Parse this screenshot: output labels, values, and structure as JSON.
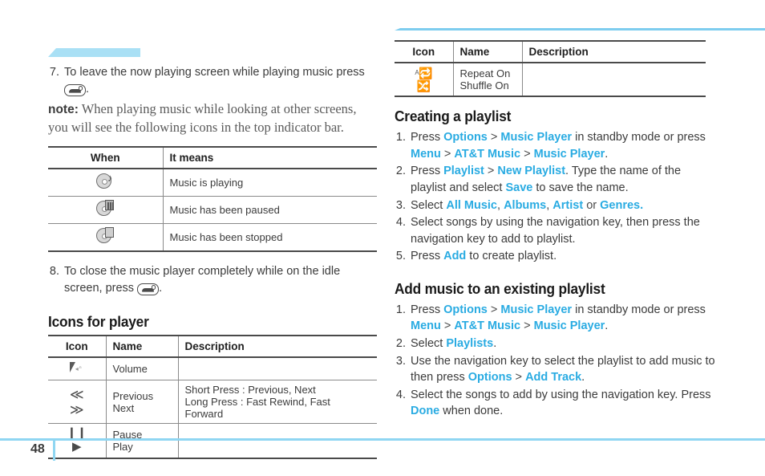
{
  "page": {
    "number": "48"
  },
  "left": {
    "step7": {
      "num": "7.",
      "text_before": "To leave the now playing screen while playing music press",
      "key_icon": "end-call-key-icon",
      "text_after": "."
    },
    "note": {
      "label": "note:",
      "text": "When playing music while looking at other screens, you will see the following icons in the top indicator bar."
    },
    "indicator_table": {
      "headers": [
        "When",
        "It means"
      ],
      "rows": [
        {
          "icon": "music-playing-icon",
          "meaning": "Music is playing"
        },
        {
          "icon": "music-paused-icon",
          "meaning": "Music has been paused"
        },
        {
          "icon": "music-stopped-icon",
          "meaning": "Music has been stopped"
        }
      ]
    },
    "step8": {
      "num": "8.",
      "line1": "To close the music player completely while on the idle",
      "line2_before": "screen, press",
      "key_icon": "end-call-key-icon",
      "line2_after": "."
    },
    "heading_icons_for_player": "Icons for player",
    "player_table": {
      "headers": [
        "Icon",
        "Name",
        "Description"
      ],
      "rows": [
        {
          "icon": "volume-icon",
          "names": [
            "Volume"
          ],
          "description": []
        },
        {
          "icon": "previous-next-icon",
          "names": [
            "Previous",
            "Next"
          ],
          "description": [
            "Short Press : Previous, Next",
            "Long Press : Fast Rewind, Fast Forward"
          ]
        },
        {
          "icon": "pause-play-icon",
          "names": [
            "Pause",
            "Play"
          ],
          "description": []
        }
      ]
    }
  },
  "right": {
    "repeat_table": {
      "headers": [
        "Icon",
        "Name",
        "Description"
      ],
      "rows": [
        {
          "icon": "repeat-shuffle-icon",
          "names": [
            "Repeat On",
            "Shuffle On"
          ],
          "description": []
        }
      ]
    },
    "creating_playlist": {
      "heading": "Creating a playlist",
      "steps": [
        {
          "num": "1.",
          "line1": {
            "pre": "Press ",
            "t1": "Options",
            "sep1": " > ",
            "t2": "Music Player",
            "post": " in standby mode or press"
          },
          "line2": {
            "t1": "Menu",
            "sep1": " > ",
            "t2": "AT&T Music",
            "sep2": " > ",
            "t3": "Music Player",
            "post": "."
          }
        },
        {
          "num": "2.",
          "line1": {
            "pre": "Press ",
            "t1": "Playlist",
            "sep1": " > ",
            "t2": "New Playlist",
            "post": ". Type the name of the"
          },
          "line2": {
            "pre": "playlist and select ",
            "t1": "Save",
            "post": " to save the name."
          }
        },
        {
          "num": "3.",
          "line1": {
            "pre": "Select ",
            "t1": "All Music",
            "sep1": ", ",
            "t2": "Albums",
            "sep2": ", ",
            "t3": "Artist",
            "sep3": " or ",
            "t4": "Genres."
          }
        },
        {
          "num": "4.",
          "line1": {
            "plain": "Select songs by using the navigation key, then press the"
          },
          "line2": {
            "plain": "navigation key to add to playlist."
          }
        },
        {
          "num": "5.",
          "line1": {
            "pre": "Press ",
            "t1": "Add",
            "post": " to create playlist."
          }
        }
      ]
    },
    "add_music": {
      "heading": "Add music to an existing playlist",
      "steps": [
        {
          "num": "1.",
          "line1": {
            "pre": "Press ",
            "t1": "Options",
            "sep1": " > ",
            "t2": "Music Player",
            "post": " in standby mode or press"
          },
          "line2": {
            "t1": "Menu",
            "sep1": " > ",
            "t2": "AT&T Music",
            "sep2": " > ",
            "t3": "Music Player",
            "post": "."
          }
        },
        {
          "num": "2.",
          "line1": {
            "pre": "Select ",
            "t1": "Playlists",
            "post": "."
          }
        },
        {
          "num": "3.",
          "line1": {
            "plain": "Use the navigation key to select the playlist to add music to"
          },
          "line2": {
            "pre": "then press ",
            "t1": "Options",
            "sep1": " > ",
            "t2": "Add Track",
            "post": "."
          }
        },
        {
          "num": "4.",
          "line1": {
            "plain": "Select the songs to add by using the navigation key. Press"
          },
          "line2": {
            "t1": "Done",
            "post": " when done."
          }
        }
      ]
    }
  },
  "colors": {
    "accent_blue": "#29abe2",
    "rule_blue": "#8fd6f2",
    "text": "#3b3b3b"
  }
}
